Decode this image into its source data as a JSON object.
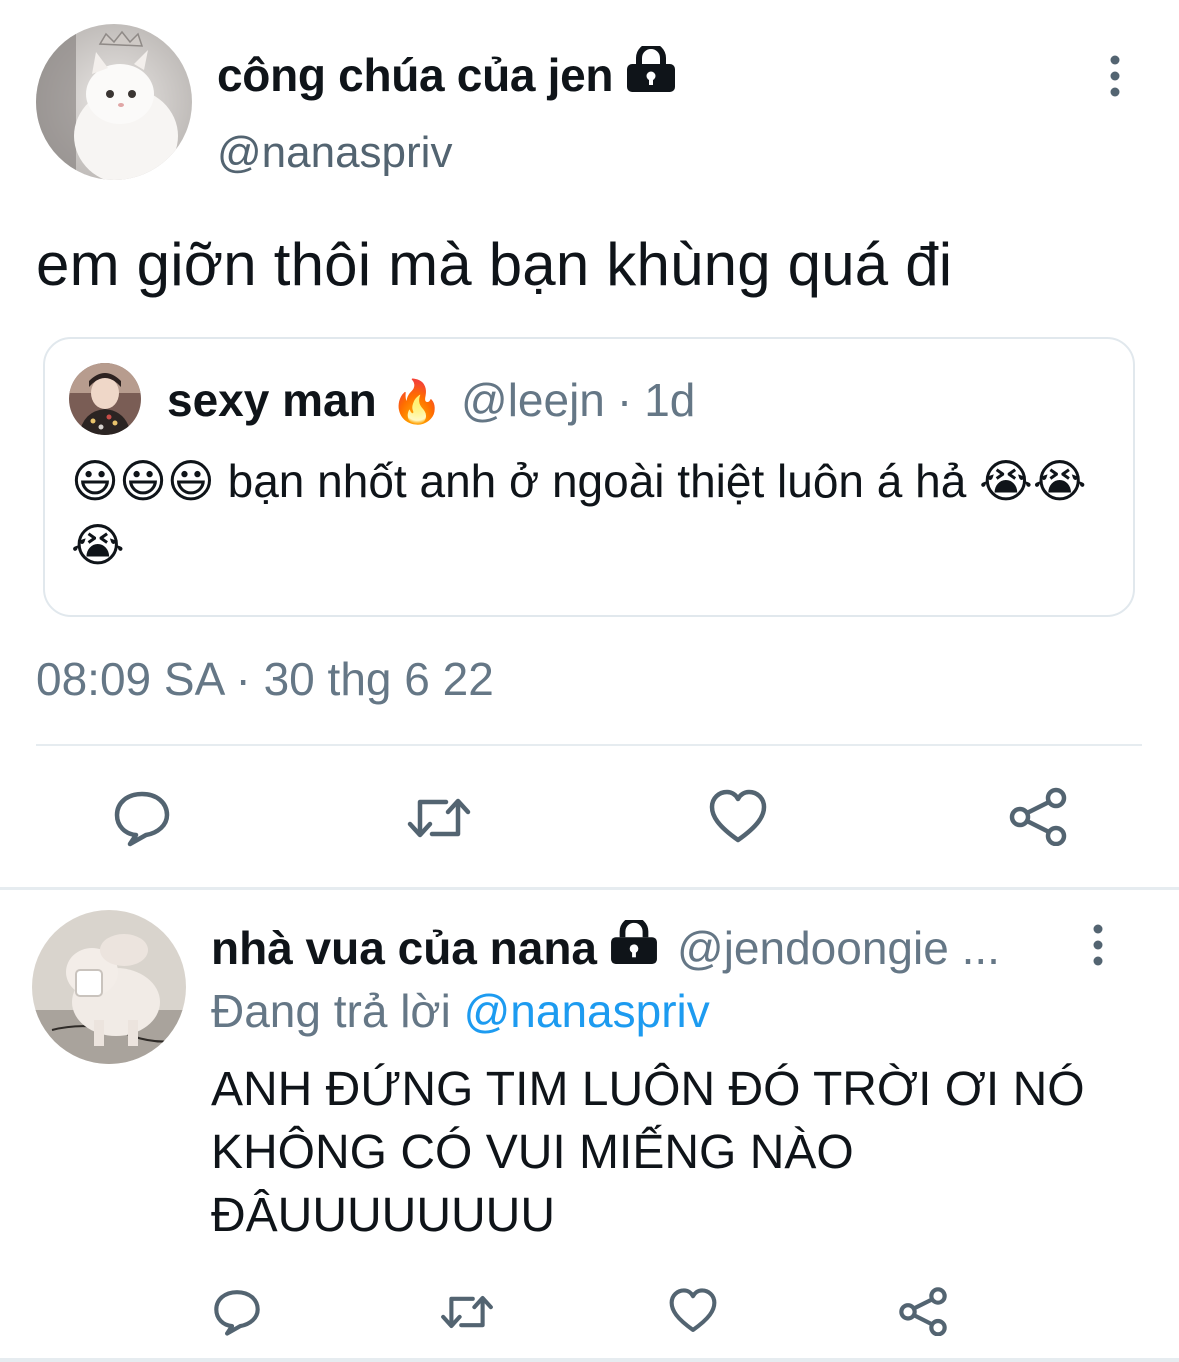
{
  "main_tweet": {
    "display_name": "công chúa của jen",
    "handle": "@nanaspriv",
    "text": "em giỡn thôi mà bạn khùng quá đi",
    "timestamp": "08:09 SA · 30 thg 6 22",
    "quoted": {
      "display_name": "sexy man",
      "name_emoji": "🔥",
      "handle": "@leejn",
      "separator": "·",
      "time": "1d",
      "text": "😃😃😃 bạn nhốt anh ở ngoài thiệt luôn á hả 😭😭😭"
    }
  },
  "reply_tweet": {
    "display_name": "nhà vua của nana",
    "handle": "@jendoongie ...",
    "replying_prefix": "Đang trả lời ",
    "replying_to": "@nanaspriv",
    "text": "ANH ĐỨNG TIM LUÔN ĐÓ TRỜI ƠI NÓ KHÔNG CÓ VUI MIẾNG NÀO ĐÂUUUUUUUU"
  },
  "icons": {
    "lock": "lock-icon",
    "more": "more-vertical-icon",
    "reply": "reply-bubble-icon",
    "retweet": "retweet-icon",
    "like": "heart-icon",
    "share": "share-icon"
  },
  "colors": {
    "text_primary": "#0f1419",
    "text_secondary": "#657786",
    "link": "#1d9bf0",
    "divider": "#e6ecf0"
  }
}
